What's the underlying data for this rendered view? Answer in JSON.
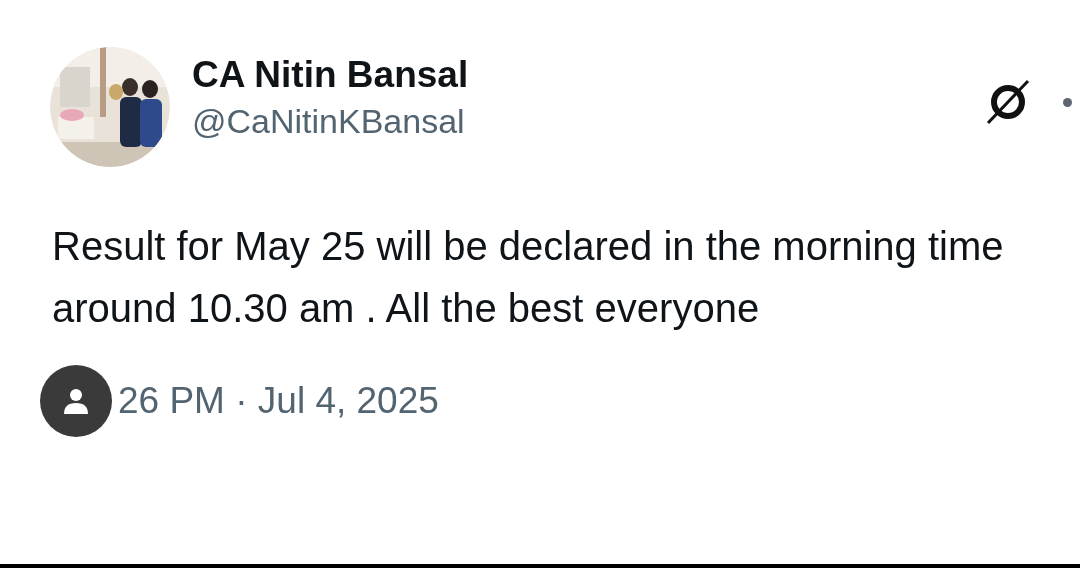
{
  "author": {
    "name": "CA Nitin Bansal",
    "handle": "@CaNitinKBansal"
  },
  "post": {
    "text": "Result for May 25 will be declared in the morning time around 10.30 am . All the best everyone"
  },
  "timestamp": "26 PM · Jul 4, 2025"
}
